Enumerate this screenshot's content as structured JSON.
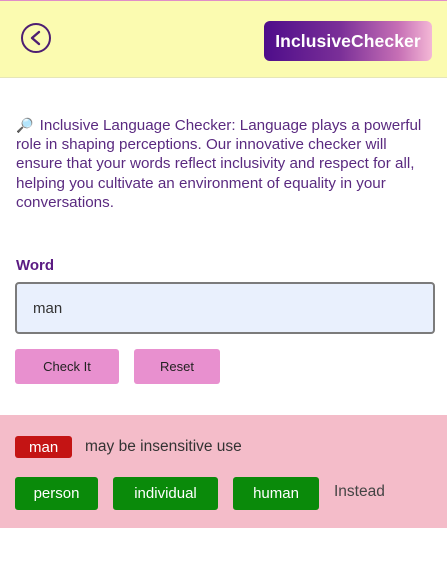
{
  "header": {
    "back_icon": "chevron-left-circle-icon",
    "brand": "InclusiveChecker"
  },
  "intro": {
    "icon": "magnifying-glass-icon",
    "text": "Inclusive Language Checker: Language plays a powerful role in shaping perceptions. Our innovative checker will ensure that your words reflect inclusivity and respect for all, helping you cultivate an environment of equality in your conversations."
  },
  "form": {
    "word_label": "Word",
    "word_value": "man",
    "check_label": "Check It",
    "reset_label": "Reset"
  },
  "result": {
    "word": "man",
    "message": "may be insensitive use",
    "alternatives": [
      "person",
      "individual",
      "human"
    ],
    "suffix": "Instead"
  },
  "colors": {
    "header_bg": "#fbfbb0",
    "accent_purple": "#4e0d8a",
    "button_pink": "#e890cf",
    "result_bg": "#f4bcc9",
    "flag_red": "#c41414",
    "alt_green": "#0a8a0a"
  }
}
